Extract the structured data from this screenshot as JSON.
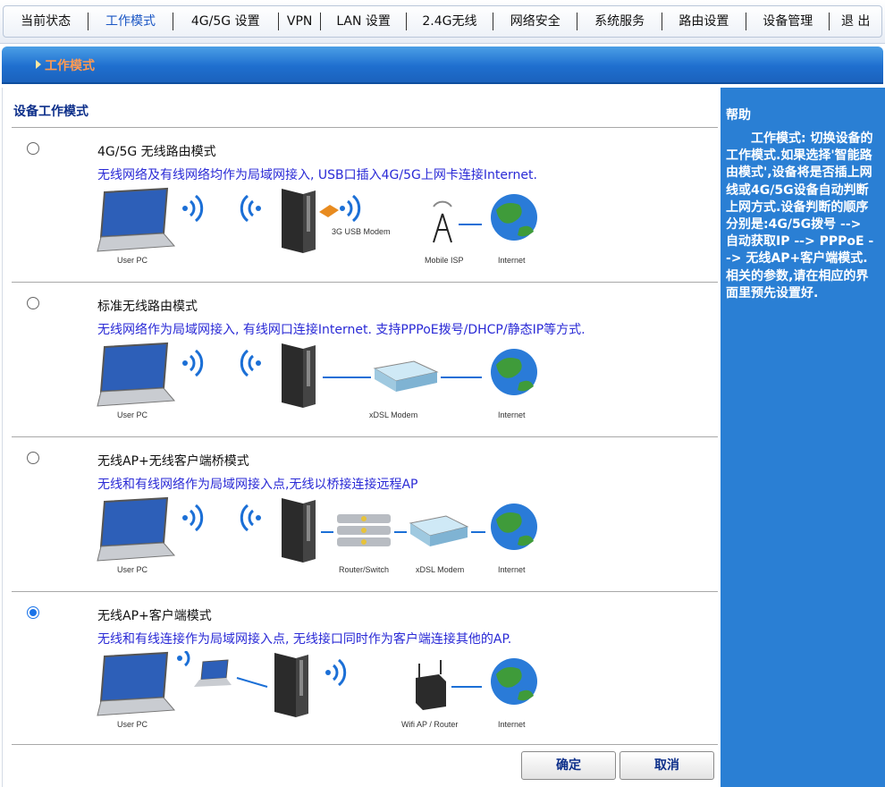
{
  "nav": {
    "items": [
      {
        "label": "当前状态",
        "width": 95
      },
      {
        "label": "工作模式",
        "width": 94,
        "active": true
      },
      {
        "label": "4G/5G 设置",
        "width": 118
      },
      {
        "label": "VPN",
        "width": 47
      },
      {
        "label": "LAN 设置",
        "width": 95
      },
      {
        "label": "2.4G无线",
        "width": 97
      },
      {
        "label": "网络安全",
        "width": 94
      },
      {
        "label": "系统服务",
        "width": 94
      },
      {
        "label": "路由设置",
        "width": 94
      },
      {
        "label": "设备管理",
        "width": 93
      },
      {
        "label": "退 出",
        "width": 58
      }
    ]
  },
  "header": {
    "title": "工作模式"
  },
  "main": {
    "title": "设备工作模式",
    "options": [
      {
        "title": "4G/5G 无线路由模式",
        "desc": "无线网络及有线网络均作为局域网接入, USB口插入4G/5G上网卡连接Internet.",
        "checked": false,
        "diagram_labels": {
          "user_pc": "User PC",
          "modem": "3G USB Modem",
          "isp": "Mobile ISP",
          "internet": "Internet"
        }
      },
      {
        "title": "标准无线路由模式",
        "desc": "无线网络作为局域网接入, 有线网口连接Internet. 支持PPPoE拨号/DHCP/静态IP等方式.",
        "checked": false,
        "diagram_labels": {
          "user_pc": "User PC",
          "modem": "xDSL Modem",
          "internet": "Internet"
        }
      },
      {
        "title": "无线AP+无线客户端桥模式",
        "desc": "无线和有线网络作为局域网接入点,无线以桥接连接远程AP",
        "checked": false,
        "diagram_labels": {
          "user_pc": "User PC",
          "router": "Router/Switch",
          "modem": "xDSL Modem",
          "internet": "Internet"
        }
      },
      {
        "title": "无线AP+客户端模式",
        "desc": "无线和有线连接作为局域网接入点, 无线接口同时作为客户端连接其他的AP.",
        "checked": true,
        "diagram_labels": {
          "user_pc": "User PC",
          "ap": "Wifi AP / Router",
          "internet": "Internet"
        }
      }
    ],
    "confirm_label": "确定",
    "cancel_label": "取消"
  },
  "help": {
    "title": "帮助",
    "body": "工作模式: 切换设备的工作模式.如果选择'智能路由模式',设备将是否插上网线或4G/5G设备自动判断上网方式.设备判断的顺序分别是:4G/5G拨号 --> 自动获取IP --> PPPoE --> 无线AP+客户端模式.相关的参数,请在相应的界面里预先设置好."
  },
  "colors": {
    "accent": "#1f6fcf",
    "help_bg": "#2a7fd4",
    "desc_text": "#2a2ad6",
    "header_title": "#ff9a52",
    "active_nav": "#1a56c4"
  }
}
